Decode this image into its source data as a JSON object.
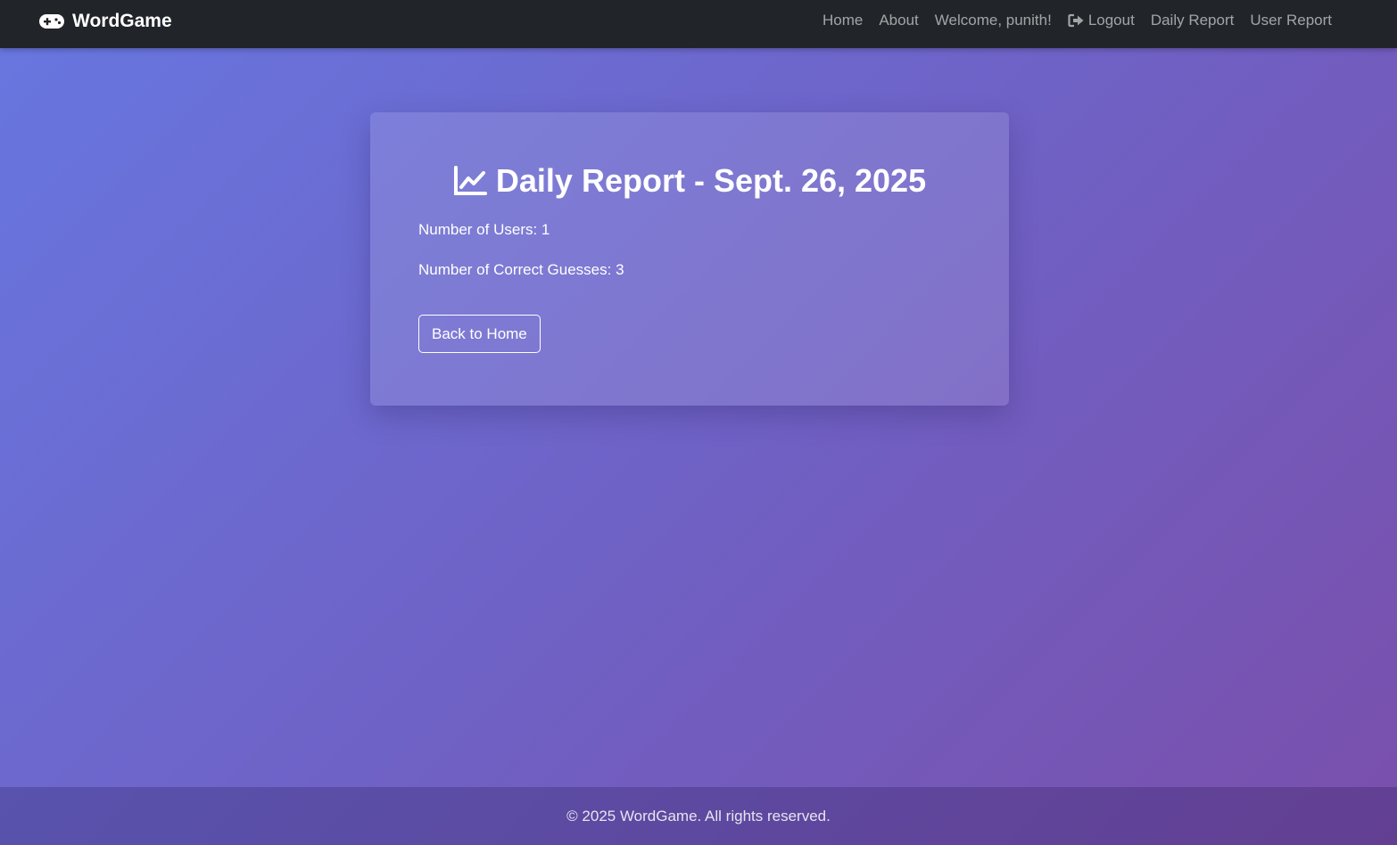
{
  "nav": {
    "brand": "WordGame",
    "brand_icon": "gamepad-icon",
    "links": {
      "home": "Home",
      "about": "About",
      "welcome": "Welcome, punith!",
      "logout": "Logout",
      "logout_icon": "sign-out-icon",
      "daily_report": "Daily Report",
      "user_report": "User Report"
    }
  },
  "report": {
    "icon": "line-chart-icon",
    "title": "Daily Report - Sept. 26, 2025",
    "users": "Number of Users: 1",
    "correct_guesses": "Number of Correct Guesses: 3",
    "back_button": "Back to Home"
  },
  "footer": {
    "text": "© 2025 WordGame. All rights reserved."
  },
  "colors": {
    "navbar": "#212529",
    "gradient_start": "#6777e0",
    "gradient_end": "#7a4fab"
  }
}
